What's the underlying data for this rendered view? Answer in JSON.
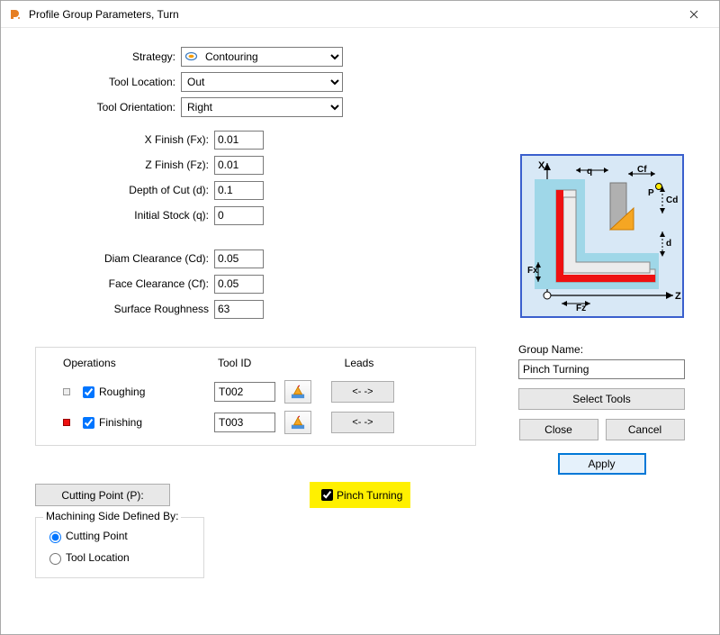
{
  "window": {
    "title": "Profile Group Parameters, Turn"
  },
  "labels": {
    "strategy": "Strategy:",
    "tool_location": "Tool Location:",
    "tool_orientation": "Tool Orientation:",
    "x_finish": "X Finish (Fx):",
    "z_finish": "Z Finish (Fz):",
    "depth_of_cut": "Depth of Cut (d):",
    "initial_stock": "Initial Stock (q):",
    "diam_clearance": "Diam Clearance (Cd):",
    "face_clearance": "Face Clearance (Cf):",
    "surface_roughness": "Surface Roughness",
    "operations": "Operations",
    "tool_id": "Tool ID",
    "leads": "Leads",
    "roughing": "Roughing",
    "finishing": "Finishing",
    "lead_arrows": "<-  ->",
    "cutting_point_btn": "Cutting Point (P):",
    "pinch_turning": "Pinch Turning",
    "machining_side": "Machining Side Defined By:",
    "cutting_point_radio": "Cutting Point",
    "tool_location_radio": "Tool Location",
    "group_name": "Group Name:",
    "select_tools": "Select Tools",
    "close": "Close",
    "cancel": "Cancel",
    "apply": "Apply"
  },
  "values": {
    "strategy": "Contouring",
    "tool_location": "Out",
    "tool_orientation": "Right",
    "x_finish": "0.01",
    "z_finish": "0.01",
    "depth_of_cut": "0.1",
    "initial_stock": "0",
    "diam_clearance": "0.05",
    "face_clearance": "0.05",
    "surface_roughness": "63",
    "roughing_checked": true,
    "finishing_checked": true,
    "roughing_tool": "T002",
    "finishing_tool": "T003",
    "pinch_checked": true,
    "machining_side": "cutting_point",
    "group_name": "Pinch Turning"
  },
  "options": {
    "strategy": [
      "Contouring"
    ],
    "tool_location": [
      "Out"
    ],
    "tool_orientation": [
      "Right"
    ]
  },
  "diagram": {
    "labels": {
      "x": "X",
      "z": "Z",
      "q": "q",
      "cf": "Cf",
      "p": "P",
      "cd": "Cd",
      "d": "d",
      "fx": "Fx",
      "fz": "Fz"
    }
  }
}
